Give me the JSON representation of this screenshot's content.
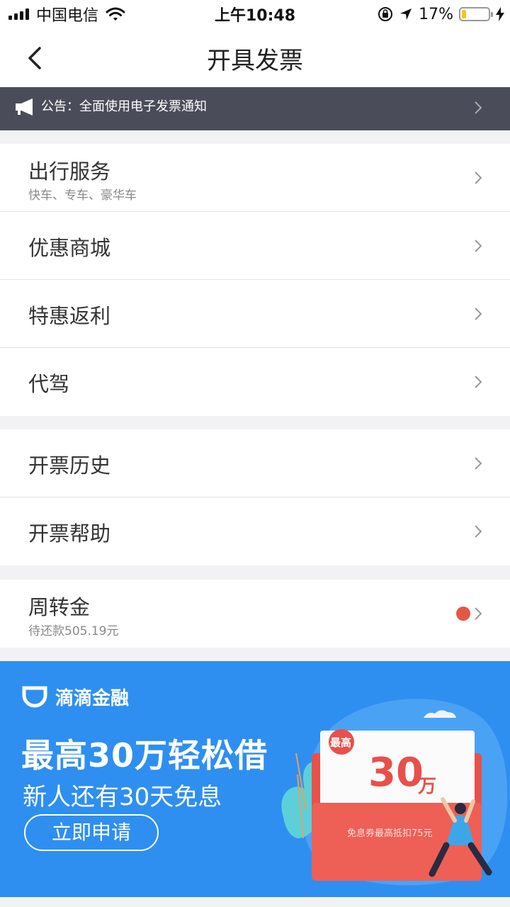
{
  "status_bar": {
    "carrier": "中国电信",
    "time": "上午10:48",
    "battery_percent": "17%",
    "battery_level": 0.17,
    "colors": {
      "battery": "#f5c518"
    }
  },
  "nav": {
    "title": "开具发票"
  },
  "notice": {
    "text": "公告：全面使用电子发票通知"
  },
  "groups": [
    {
      "items": [
        {
          "title": "出行服务",
          "subtitle": "快车、专车、豪华车"
        },
        {
          "title": "优惠商城"
        },
        {
          "title": "特惠返利"
        },
        {
          "title": "代驾"
        }
      ]
    },
    {
      "items": [
        {
          "title": "开票历史"
        },
        {
          "title": "开票帮助"
        }
      ]
    },
    {
      "items": [
        {
          "title": "周转金",
          "subtitle": "待还款505.19元",
          "badge": "red-dot"
        }
      ]
    }
  ],
  "banner": {
    "brand": "滴滴金融",
    "headline": "最高30万轻松借",
    "subline": "新人还有30天免息",
    "button": "立即申请",
    "ticket_label": "最高",
    "ticket_amount": "30",
    "ticket_unit": "万",
    "ticket_note": "免息券最高抵扣75元",
    "colors": {
      "background": "#2e8ff0",
      "ticket": "#e8504a"
    }
  }
}
